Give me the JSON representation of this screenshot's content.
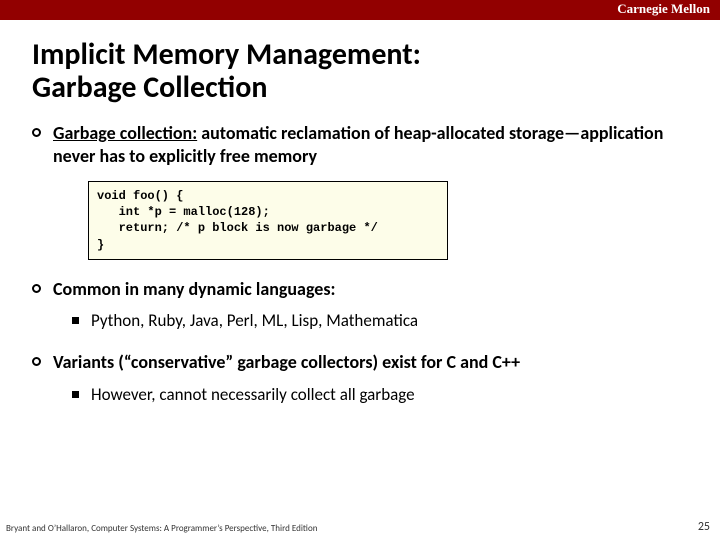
{
  "brand": "Carnegie Mellon",
  "title_line1": "Implicit Memory Management:",
  "title_line2": "Garbage Collection",
  "bullet1_lead": "Garbage collection:",
  "bullet1_rest": " automatic reclamation of heap-allocated storage—application never has to explicitly free memory",
  "code": "void foo() {\n   int *p = malloc(128);\n   return; /* p block is now garbage */\n}",
  "bullet2": "Common in many dynamic languages:",
  "sub2": "Python, Ruby, Java, Perl, ML, Lisp, Mathematica",
  "bullet3": "Variants (“conservative” garbage collectors) exist for C and C++",
  "sub3": "However, cannot necessarily collect all garbage",
  "footer_left": "Bryant and O’Hallaron, Computer Systems: A Programmer’s Perspective, Third Edition",
  "footer_right": "25"
}
